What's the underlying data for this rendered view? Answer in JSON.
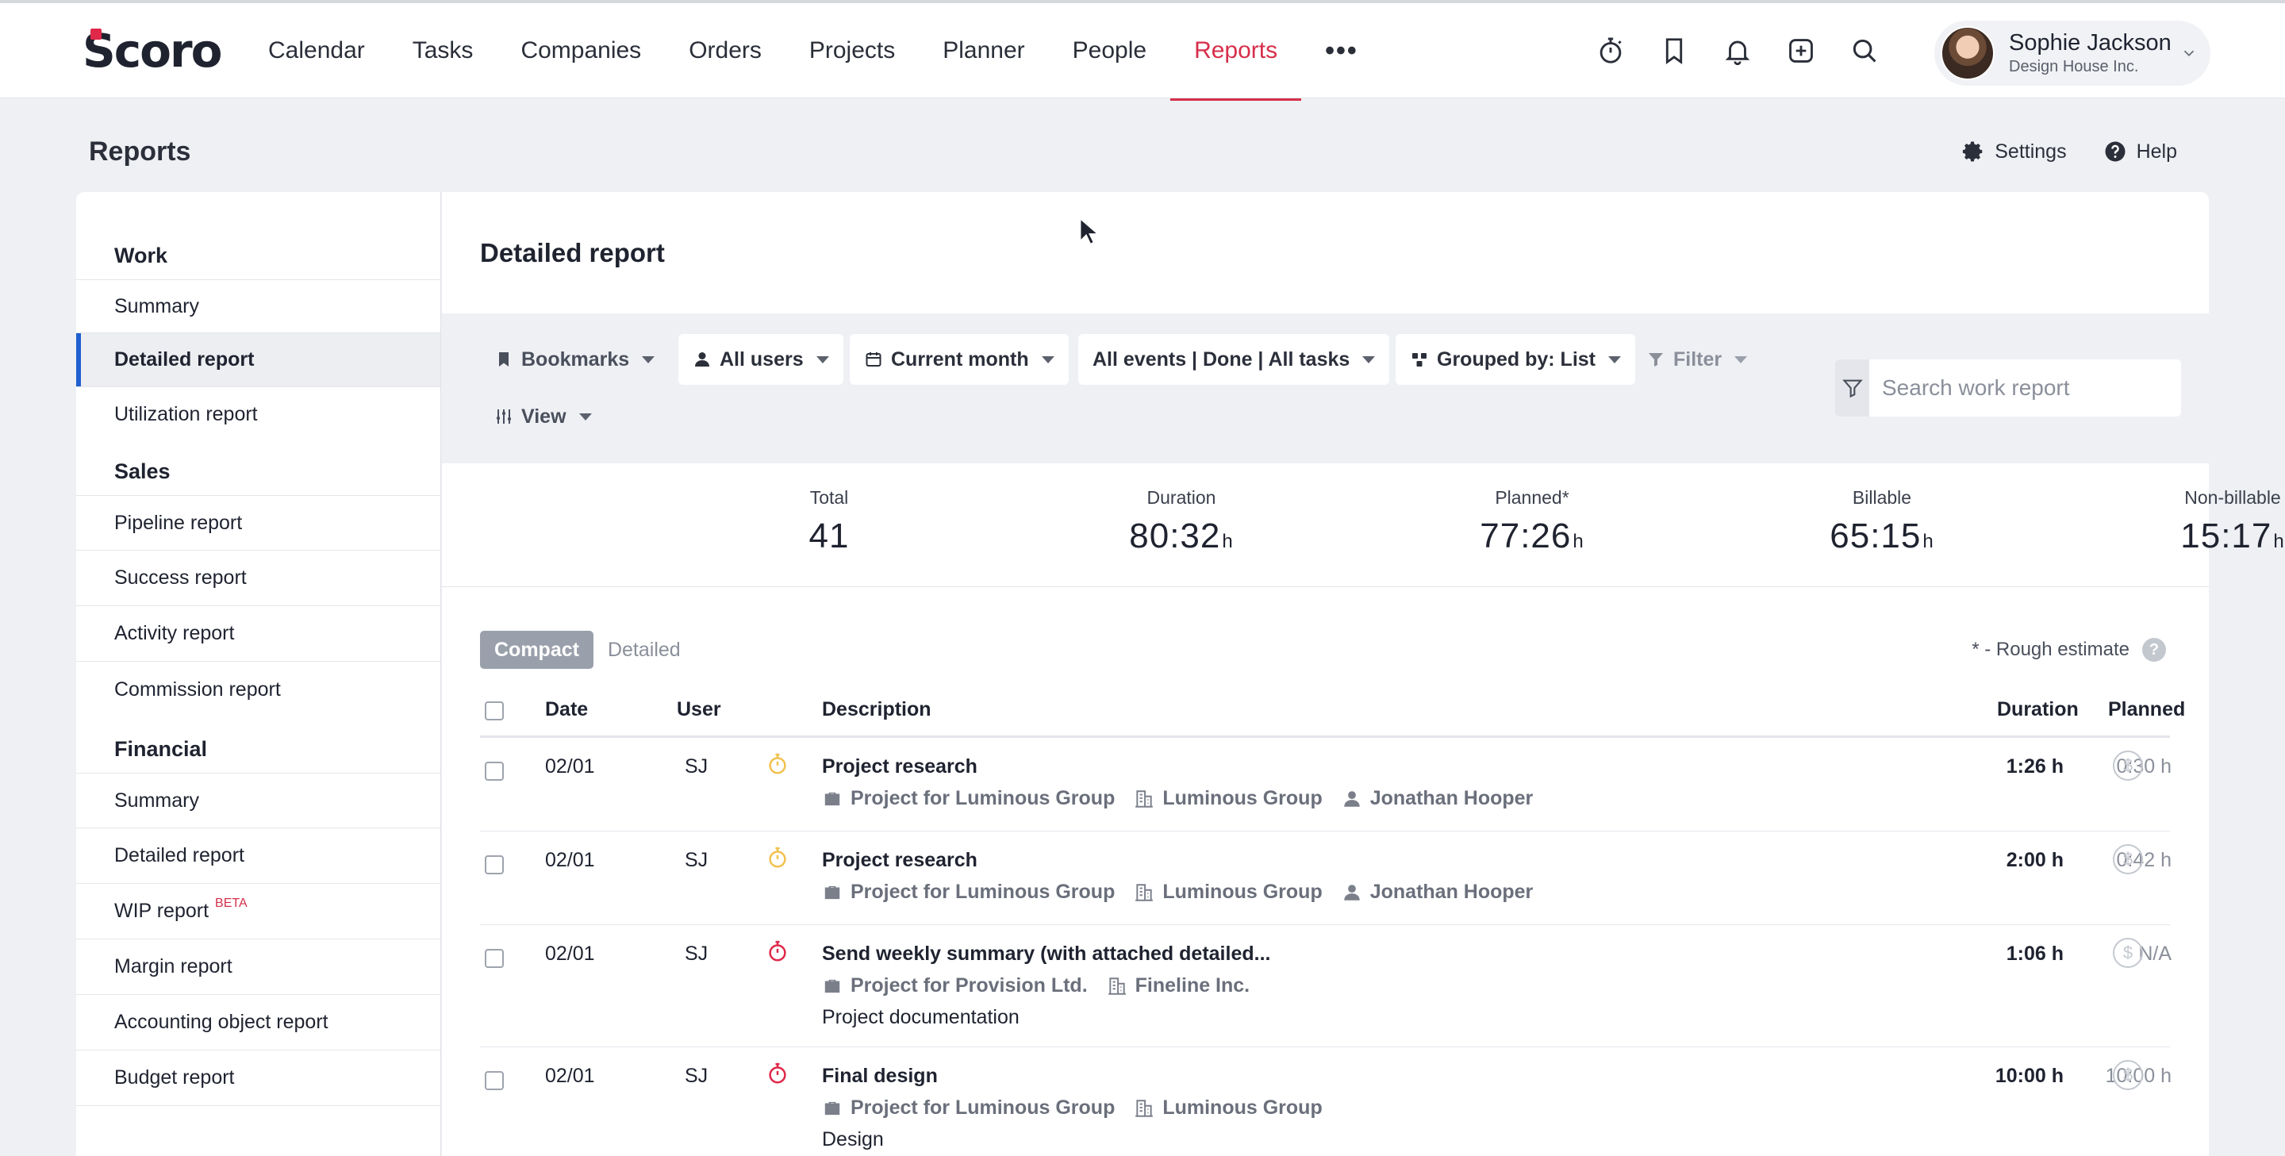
{
  "app": {
    "logo_text": "Scoro",
    "nav": [
      "Calendar",
      "Tasks",
      "Companies",
      "Orders",
      "Projects",
      "Planner",
      "People",
      "Reports"
    ],
    "nav_active": "Reports",
    "nav_more": "•••",
    "icons": [
      "stopwatch-icon",
      "bookmark-icon",
      "bell-icon",
      "add-icon",
      "search-icon"
    ],
    "user": {
      "name": "Sophie Jackson",
      "company": "Design House Inc."
    }
  },
  "page": {
    "title": "Reports",
    "settings_label": "Settings",
    "help_label": "Help"
  },
  "sidebar": {
    "groups": [
      {
        "label": "Work",
        "items": [
          "Summary",
          "Detailed report",
          "Utilization report"
        ]
      },
      {
        "label": "Sales",
        "items": [
          "Pipeline report",
          "Success report",
          "Activity report",
          "Commission report"
        ]
      },
      {
        "label": "Financial",
        "items": [
          "Summary",
          "Detailed report",
          "WIP report",
          "Margin report",
          "Accounting object report",
          "Budget report"
        ]
      }
    ],
    "active_item": "Detailed report",
    "wip_badge": "BETA"
  },
  "report": {
    "title": "Detailed report",
    "toolbar": {
      "bookmarks": "Bookmarks",
      "users": "All users",
      "period": "Current month",
      "events": "All events | Done | All tasks",
      "grouped": "Grouped by: List",
      "filter": "Filter",
      "view": "View",
      "search_placeholder": "Search work report"
    },
    "stats": [
      {
        "label": "Total",
        "value": "41",
        "unit": ""
      },
      {
        "label": "Duration",
        "value": "80:32",
        "unit": "h"
      },
      {
        "label": "Planned*",
        "value": "77:26",
        "unit": "h"
      },
      {
        "label": "Billable",
        "value": "65:15",
        "unit": "h"
      },
      {
        "label": "Non-billable",
        "value": "15:17",
        "unit": "h"
      }
    ],
    "view_modes": [
      "Compact",
      "Detailed"
    ],
    "view_active": "Compact",
    "rough_estimate": "* - Rough estimate",
    "columns": {
      "date": "Date",
      "user": "User",
      "description": "Description",
      "duration": "Duration",
      "planned": "Planned"
    },
    "rows": [
      {
        "date": "02/01",
        "user": "SJ",
        "timer_color": "#f2c14e",
        "title": "Project research",
        "project": "Project for Luminous Group",
        "company": "Luminous Group",
        "person": "Jonathan Hooper",
        "extra": "",
        "duration": "1:26 h",
        "planned": "0:30 h"
      },
      {
        "date": "02/01",
        "user": "SJ",
        "timer_color": "#f2c14e",
        "title": "Project research",
        "project": "Project for Luminous Group",
        "company": "Luminous Group",
        "person": "Jonathan Hooper",
        "extra": "",
        "duration": "2:00 h",
        "planned": "0:42 h"
      },
      {
        "date": "02/01",
        "user": "SJ",
        "timer_color": "#e0284a",
        "title": "Send weekly summary (with attached detailed...",
        "project": "Project for Provision Ltd.",
        "company": "Fineline Inc.",
        "person": "",
        "extra": "Project documentation",
        "duration": "1:06 h",
        "planned": "N/A"
      },
      {
        "date": "02/01",
        "user": "SJ",
        "timer_color": "#e0284a",
        "title": "Final design",
        "project": "Project for Luminous Group",
        "company": "Luminous Group",
        "person": "",
        "extra": "Design",
        "duration": "10:00 h",
        "planned": "10:00 h"
      }
    ],
    "billing_symbol": "$",
    "help_symbol": "?"
  },
  "colors": {
    "accent": "#d62f4b",
    "active_bar": "#1f5fd1",
    "background": "#eef0f4"
  }
}
